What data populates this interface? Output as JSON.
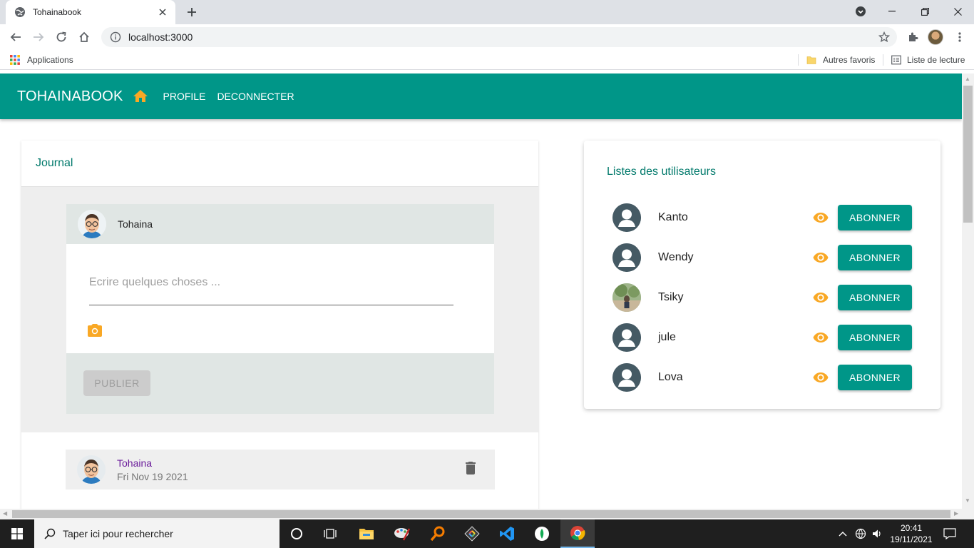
{
  "browser": {
    "tab_title": "Tohainabook",
    "url": "localhost:3000",
    "bookmarks": {
      "apps_label": "Applications",
      "other_favorites": "Autres favoris",
      "reading_list": "Liste de lecture"
    }
  },
  "app": {
    "brand": "TOHAINABOOK",
    "nav": [
      "PROFILE",
      "DECONNECTER"
    ],
    "accent_color": "#009688",
    "icon_color": "#f9a825"
  },
  "journal": {
    "title": "Journal",
    "composer": {
      "user": "Tohaina",
      "placeholder": "Ecrire quelques choses ...",
      "publish_label": "PUBLIER"
    },
    "posts": [
      {
        "user": "Tohaina",
        "date": "Fri Nov 19 2021"
      }
    ]
  },
  "users_panel": {
    "title": "Listes des utilisateurs",
    "follow_label": "ABONNER",
    "users": [
      {
        "name": "Kanto",
        "avatar": "default"
      },
      {
        "name": "Wendy",
        "avatar": "default"
      },
      {
        "name": "Tsiky",
        "avatar": "photo"
      },
      {
        "name": "jule",
        "avatar": "default"
      },
      {
        "name": "Lova",
        "avatar": "default"
      }
    ]
  },
  "taskbar": {
    "search_placeholder": "Taper ici pour rechercher",
    "time": "20:41",
    "date": "19/11/2021"
  }
}
